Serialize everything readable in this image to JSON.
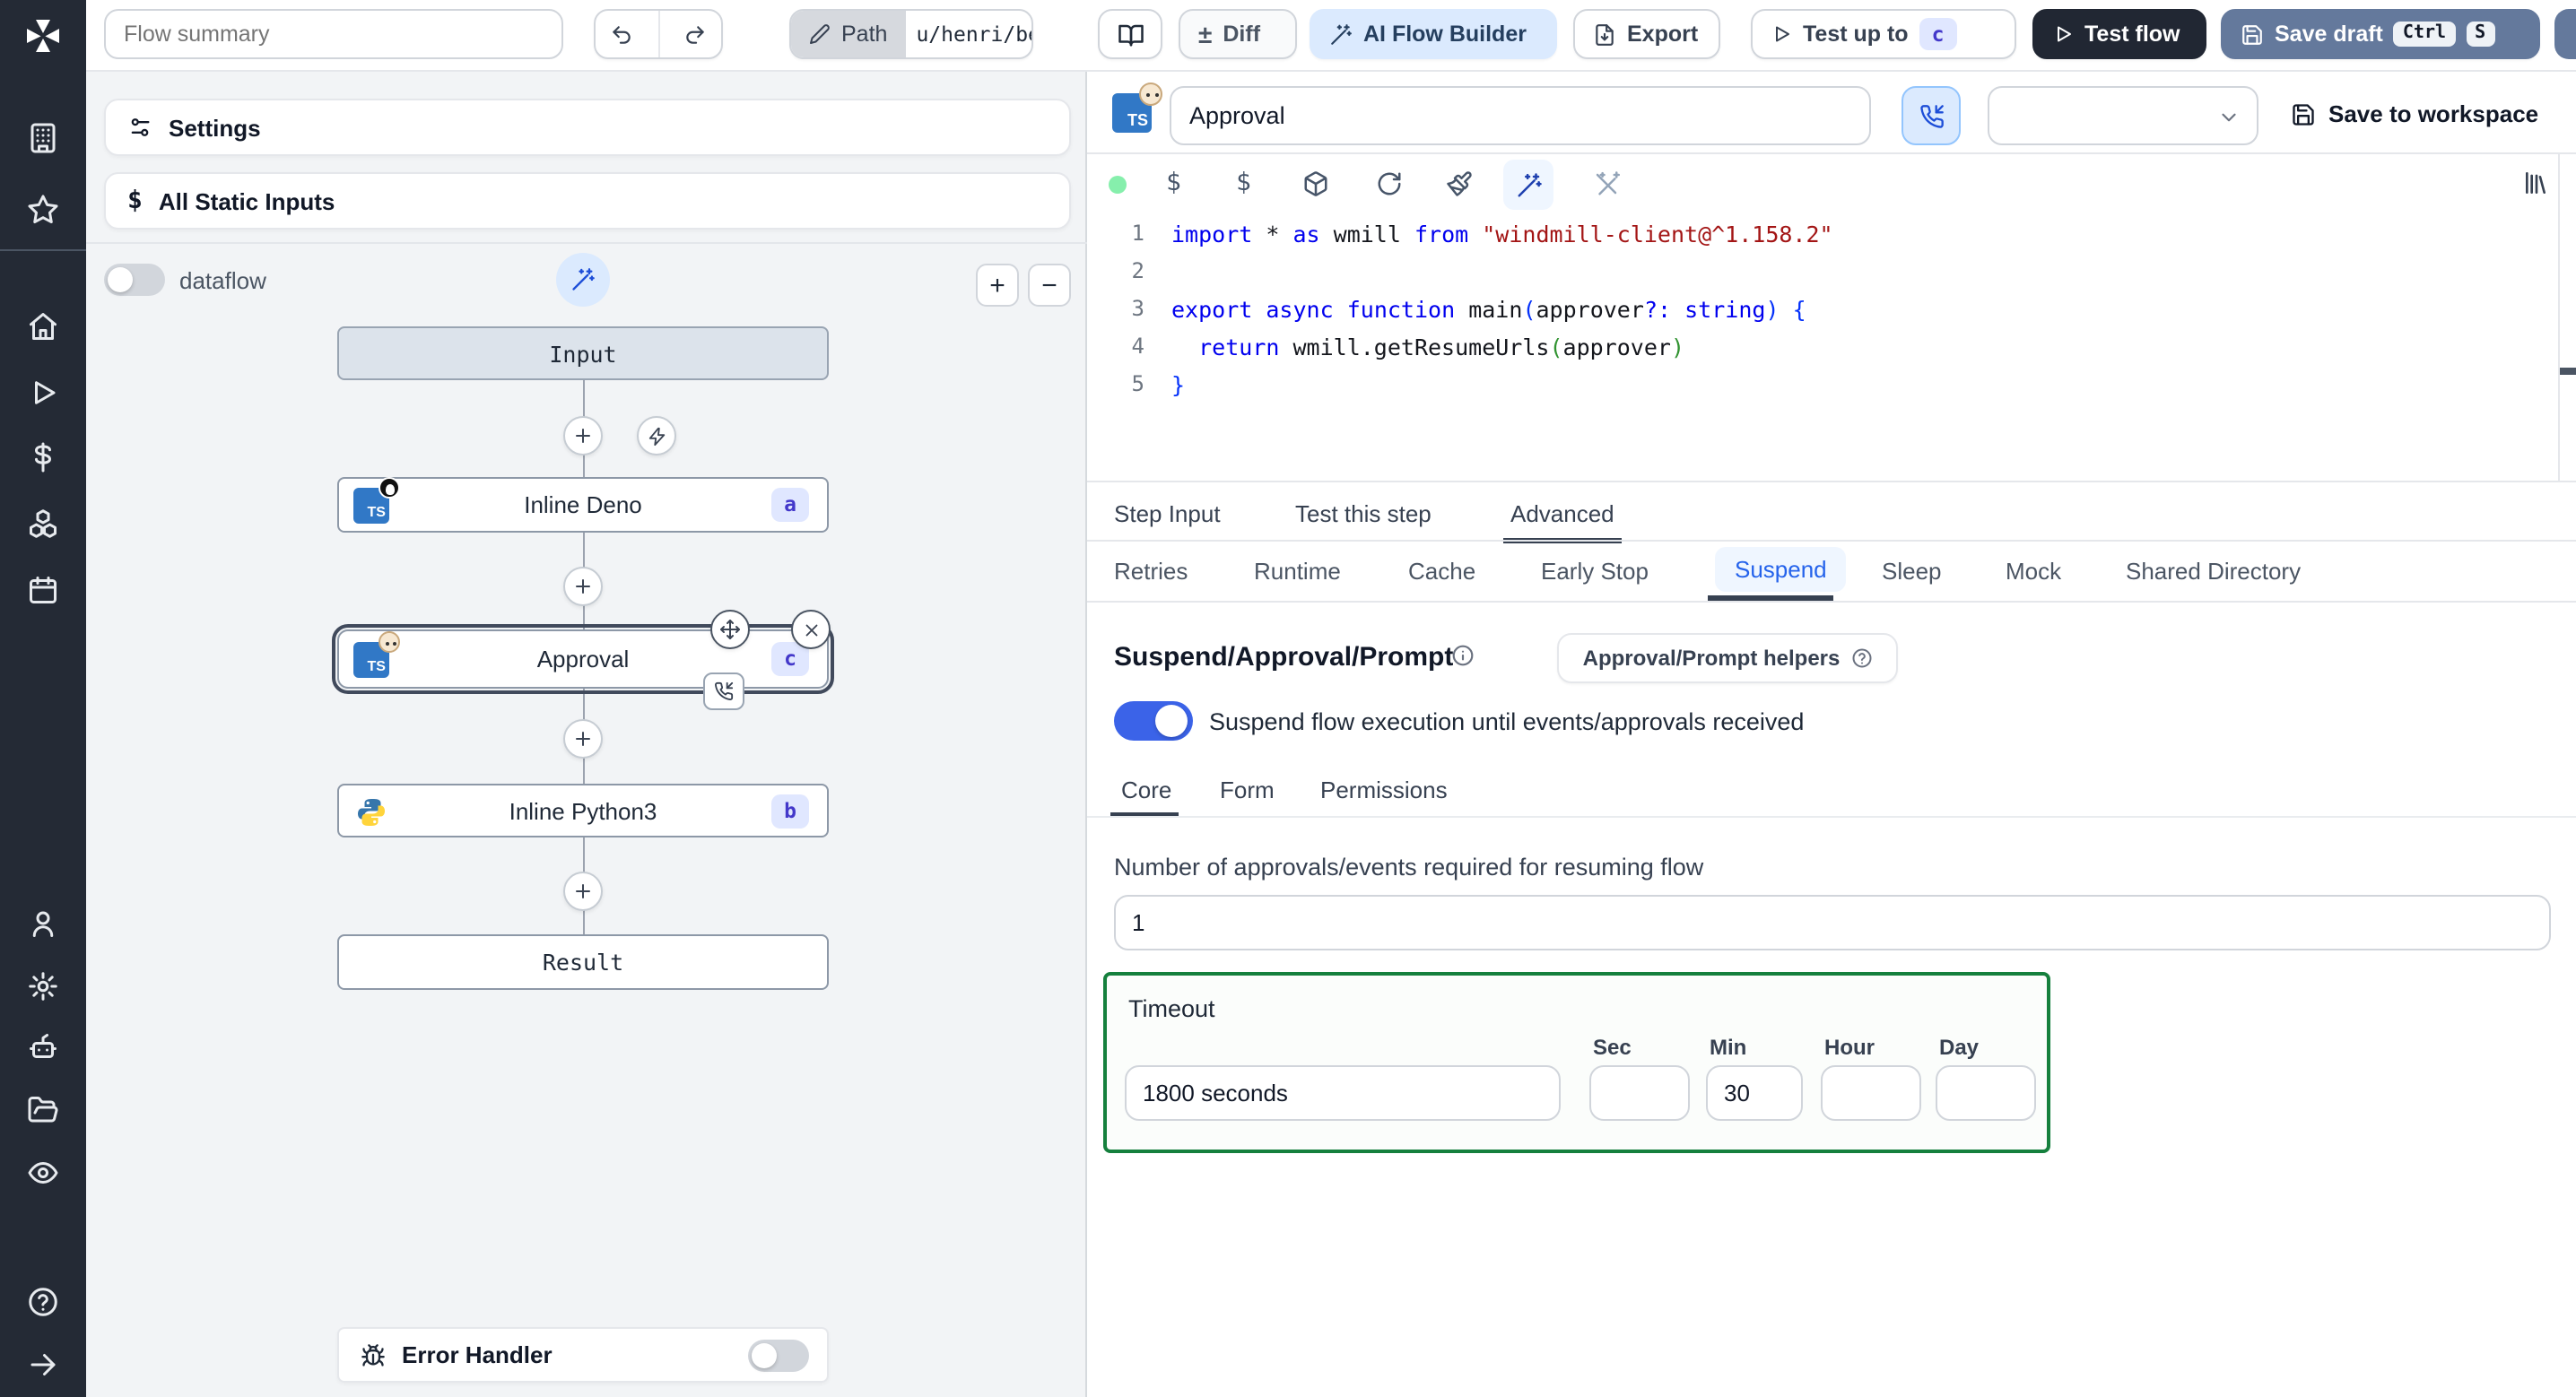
{
  "topbar": {
    "flow_summary_placeholder": "Flow summary",
    "path_label": "Path",
    "path_value": "u/henri/bes",
    "diff_symbol": "±",
    "diff_label": "Diff",
    "ai_flow_builder_label": "AI Flow Builder",
    "export_label": "Export",
    "test_up_to_label": "Test up to",
    "test_up_to_badge": "c",
    "test_flow_label": "Test flow",
    "save_draft_label": "Save draft",
    "kbd_ctrl": "Ctrl",
    "kbd_s": "S"
  },
  "flow_panel": {
    "settings_label": "Settings",
    "static_inputs_label": "All Static Inputs",
    "static_inputs_icon_glyph": "$",
    "dataflow_label": "dataflow",
    "zoom_in_glyph": "+",
    "zoom_out_glyph": "−",
    "nodes": {
      "input_label": "Input",
      "deno": {
        "label": "Inline Deno",
        "badge": "a",
        "lang": "TS"
      },
      "approval": {
        "label": "Approval",
        "badge": "c",
        "lang": "TS"
      },
      "python": {
        "label": "Inline Python3",
        "badge": "b"
      },
      "result_label": "Result"
    },
    "error_handler_label": "Error Handler"
  },
  "step_editor": {
    "title_value": "Approval",
    "lang_badge": "TS",
    "save_to_workspace_label": "Save to workspace",
    "toolbar_dollar_glyph": "$",
    "code": {
      "line_numbers": [
        "1",
        "2",
        "3",
        "4",
        "5"
      ],
      "lines": [
        [
          {
            "c": "kw",
            "t": "import"
          },
          {
            "c": "pl",
            "t": " * "
          },
          {
            "c": "kw",
            "t": "as"
          },
          {
            "c": "pl",
            "t": " wmill "
          },
          {
            "c": "kw",
            "t": "from"
          },
          {
            "c": "pl",
            "t": " "
          },
          {
            "c": "str",
            "t": "\"windmill-client@^1.158.2\""
          }
        ],
        [],
        [
          {
            "c": "kw",
            "t": "export"
          },
          {
            "c": "pl",
            "t": " "
          },
          {
            "c": "kw",
            "t": "async"
          },
          {
            "c": "pl",
            "t": " "
          },
          {
            "c": "kw",
            "t": "function"
          },
          {
            "c": "pl",
            "t": " main"
          },
          {
            "c": "br1",
            "t": "("
          },
          {
            "c": "pl",
            "t": "approver"
          },
          {
            "c": "kw",
            "t": "?:"
          },
          {
            "c": "pl",
            "t": " "
          },
          {
            "c": "kw",
            "t": "string"
          },
          {
            "c": "br1",
            "t": ")"
          },
          {
            "c": "pl",
            "t": " "
          },
          {
            "c": "br1",
            "t": "{"
          }
        ],
        [
          {
            "c": "pl",
            "t": "  "
          },
          {
            "c": "kw",
            "t": "return"
          },
          {
            "c": "pl",
            "t": " wmill.getResumeUrls"
          },
          {
            "c": "br2",
            "t": "("
          },
          {
            "c": "pl",
            "t": "approver"
          },
          {
            "c": "br2",
            "t": ")"
          }
        ],
        [
          {
            "c": "br1",
            "t": "}"
          }
        ]
      ]
    },
    "tabs": [
      "Step Input",
      "Test this step",
      "Advanced"
    ],
    "active_tab": "Advanced",
    "advanced_tabs": [
      "Retries",
      "Runtime",
      "Cache",
      "Early Stop",
      "Suspend",
      "Sleep",
      "Mock",
      "Shared Directory"
    ],
    "active_advanced_tab": "Suspend"
  },
  "suspend": {
    "heading": "Suspend/Approval/Prompt",
    "helpers_button_label": "Approval/Prompt helpers",
    "toggle_label": "Suspend flow execution until events/approvals received",
    "tabs": [
      "Core",
      "Form",
      "Permissions"
    ],
    "active_tab": "Core",
    "approvals_label": "Number of approvals/events required for resuming flow",
    "approvals_value": "1",
    "timeout": {
      "label": "Timeout",
      "value": "1800 seconds",
      "units": [
        {
          "label": "Sec",
          "value": ""
        },
        {
          "label": "Min",
          "value": "30"
        },
        {
          "label": "Hour",
          "value": ""
        },
        {
          "label": "Day",
          "value": ""
        }
      ]
    }
  },
  "colors": {
    "accent_blue": "#2563eb",
    "toggle_on": "#3b63e8",
    "timeout_border_green": "#15803d",
    "save_draft_bg": "#64799c",
    "test_flow_bg": "#212733",
    "badge_bg": "#e0e7ff",
    "badge_text": "#4338ca",
    "status_dot_green": "#86efac"
  }
}
